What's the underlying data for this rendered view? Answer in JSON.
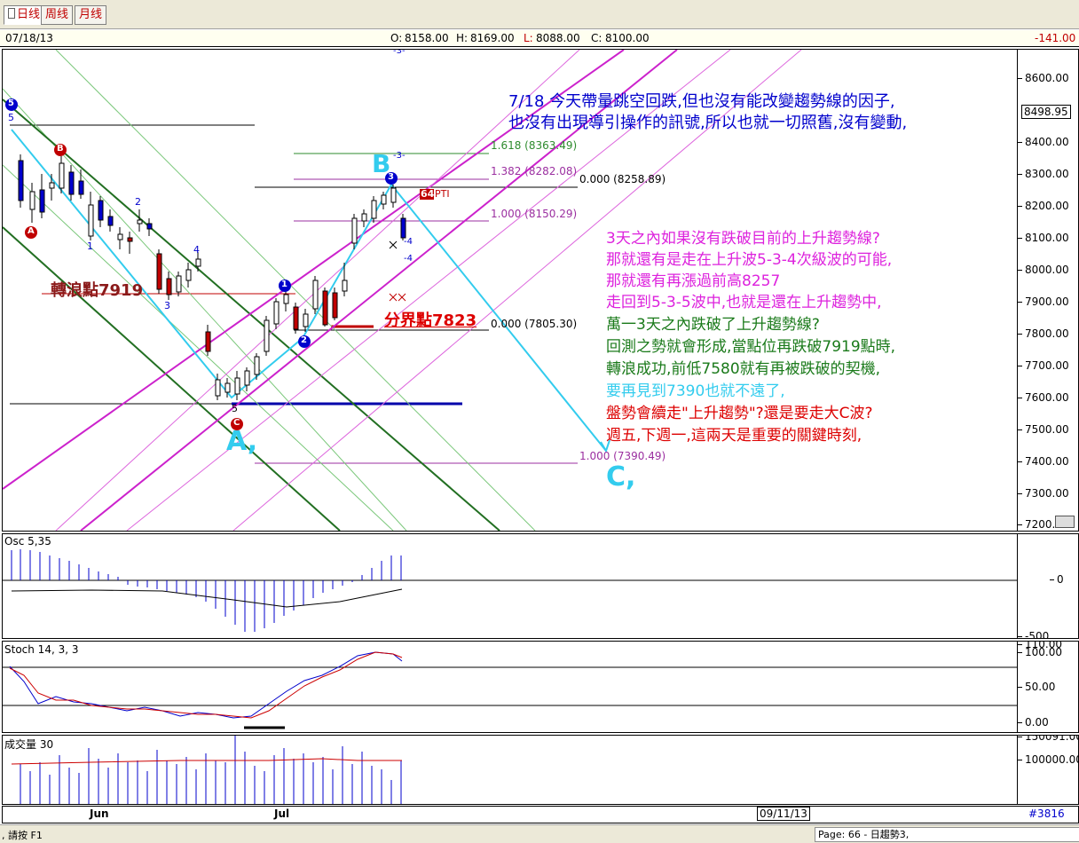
{
  "tabs": [
    {
      "label": "日线",
      "active": true
    },
    {
      "label": "周线",
      "active": false
    },
    {
      "label": "月线",
      "active": false
    }
  ],
  "quote": {
    "date": "07/18/13",
    "open_label": "O:",
    "open": "8158.00",
    "high_label": "H:",
    "high": "8169.00",
    "low_label": "L:",
    "low": "8088.00",
    "close_label": "C:",
    "close": "8100.00",
    "change": "-141.00"
  },
  "price_axis": {
    "ticks": [
      "8600.00",
      "8400.00",
      "8300.00",
      "8200.00",
      "8100.00",
      "8000.00",
      "7900.00",
      "7800.00",
      "7700.00",
      "7600.00",
      "7500.00",
      "7400.00",
      "7300.00",
      "7200.00"
    ],
    "last_price": "8498.95"
  },
  "fib_levels": [
    {
      "label": "1.618 (8363.49)",
      "color": "#2e8b2e"
    },
    {
      "label": "1.382 (8282.08)",
      "color": "#9b2fa0"
    },
    {
      "label": "0.000 (8258.89)",
      "color": "#000000"
    },
    {
      "label": "1.000 (8150.29)",
      "color": "#9b2fa0"
    },
    {
      "label": "0.000 (7805.30)",
      "color": "#000000"
    },
    {
      "label": "1.000 (7390.49)",
      "color": "#9b2fa0"
    }
  ],
  "wave_labels": {
    "five": "5",
    "B_circle": "B",
    "A_circle": "A",
    "C_circle": "C",
    "B_big": "B",
    "A_big": "A,",
    "C_big": "C,",
    "n1": "1",
    "n2": "2",
    "n3": "3",
    "n4": "4",
    "n5": "5",
    "wave3_circle": "3",
    "wave1_circle": "1",
    "wave2_circle": "2",
    "pti_number": "64",
    "pti": "PTI",
    "minus3_top": "-3-",
    "minus3_b": "-3-",
    "minus4a": "-4",
    "minus4b": "-4"
  },
  "markers": {
    "turn_point": "轉浪點7919",
    "divide_point": "分界點7823"
  },
  "commentary": {
    "line1": "7/18 今天帶量跳空回跌,但也沒有能改變趨勢線的因子,",
    "line2": "也沒有出現導引操作的訊號,所以也就一切照舊,沒有變動,",
    "p1": "3天之內如果沒有跌破目前的上升趨勢線?",
    "p2": "那就還有是走在上升波5-3-4次級波的可能,",
    "p3": "那就還有再漲過前高8257",
    "p4": "走回到5-3-5波中,也就是還在上升趨勢中,",
    "p5": "萬一3天之內跌破了上升趨勢線?",
    "p6": "回測之勢就會形成,當點位再跌破7919點時,",
    "p7": "轉浪成功,前低7580就有再被跌破的契機,",
    "p8": "要再見到7390也就不遠了,",
    "p9": "盤勢會續走\"上升趨勢\"?還是要走大C波?",
    "p10": "週五,下週一,這兩天是重要的關鍵時刻,"
  },
  "osc": {
    "title": "Osc 5,35",
    "zero": "0",
    "bottom": "-500"
  },
  "stoch": {
    "title": "Stoch 14, 3, 3",
    "ticks": [
      "110.00",
      "100.00",
      "50.00",
      "0.00"
    ]
  },
  "volume": {
    "title": "成交量 30",
    "ticks": [
      "150091.00",
      "100000.00"
    ]
  },
  "x_axis": {
    "jun": "Jun",
    "jul": "Jul",
    "cursor_date": "09/11/13",
    "symbol": "#3816"
  },
  "status": {
    "help": ", 請按 F1",
    "page": "Page: 66 - 日趨勢3,"
  },
  "colors": {
    "up": "#ffffff",
    "down": "#c00000",
    "blue": "#0000cc",
    "cyan": "#33ccee",
    "magenta": "#cc22cc",
    "green": "#228822"
  }
}
